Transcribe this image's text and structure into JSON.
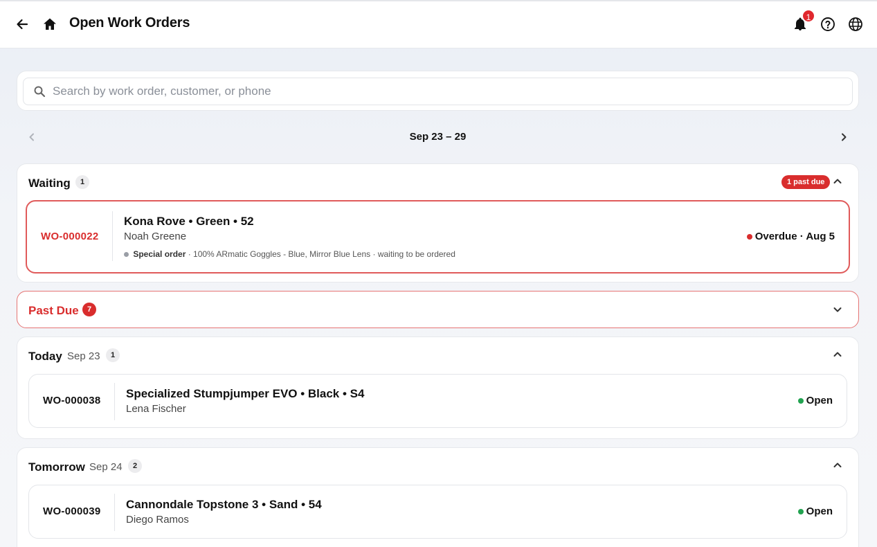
{
  "header": {
    "title": "Open Work Orders",
    "notification_count": "1"
  },
  "search": {
    "placeholder": "Search by work order, customer, or phone"
  },
  "week": {
    "label": "Sep 23 – 29"
  },
  "sections": {
    "waiting": {
      "title": "Waiting",
      "count": "1",
      "past_due_badge": "1 past due",
      "orders": [
        {
          "id": "WO-000022",
          "bike": "Kona Rove • Green • 52",
          "customer": "Noah Greene",
          "note_label": "Special order",
          "note_text": " · 100% ARmatic Goggles - Blue, Mirror Blue Lens · waiting to be ordered",
          "status": "Overdue · Aug 5"
        }
      ]
    },
    "past_due": {
      "title": "Past Due",
      "count": "7"
    },
    "today": {
      "title": "Today",
      "date": "Sep 23",
      "count": "1",
      "orders": [
        {
          "id": "WO-000038",
          "bike": "Specialized Stumpjumper EVO • Black • S4",
          "customer": "Lena Fischer",
          "status": "Open"
        }
      ]
    },
    "tomorrow": {
      "title": "Tomorrow",
      "date": "Sep 24",
      "count": "2",
      "orders": [
        {
          "id": "WO-000039",
          "bike": "Cannondale Topstone 3 • Sand • 54",
          "customer": "Diego Ramos",
          "status": "Open"
        }
      ]
    }
  },
  "colors": {
    "danger": "#d92d2d",
    "open": "#22a350"
  }
}
